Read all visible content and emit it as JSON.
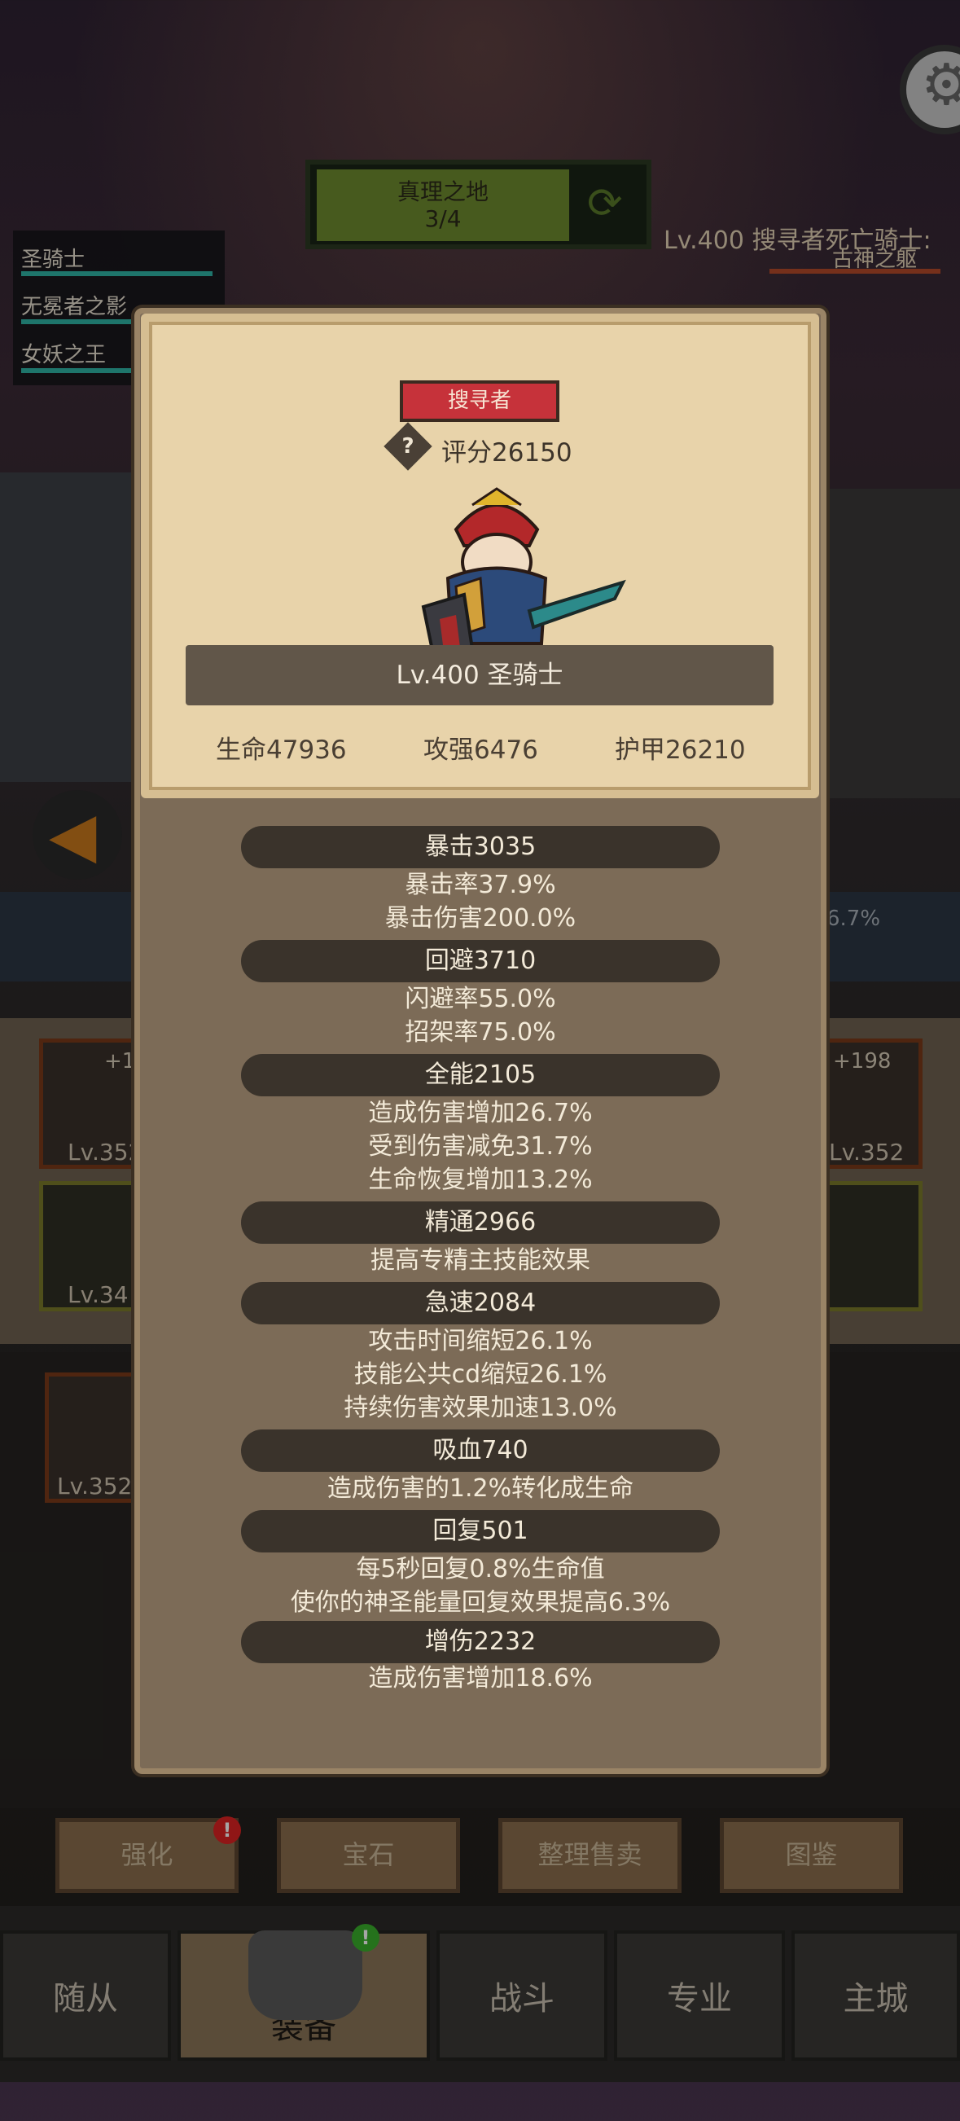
{
  "top": {
    "stage_title": "真理之地",
    "stage_progress": "3/4",
    "boss_label": "Lv.400 搜寻者死亡骑士:",
    "boss_sub": "古神之躯"
  },
  "party": [
    "圣骑士",
    "无冕者之影",
    "女妖之王"
  ],
  "background_slots": {
    "left_top_level": "Lv.352",
    "left_top_plus": "+1",
    "right_top_level": "Lv.352",
    "right_top_plus": "+198",
    "left_mid_level": "Lv.34",
    "left_low_level": "Lv.352",
    "right_pct": "6.7%"
  },
  "actions": [
    "强化",
    "宝石",
    "整理售卖",
    "图鉴"
  ],
  "nav": [
    "随从",
    "装备",
    "战斗",
    "专业",
    "主城"
  ],
  "popup": {
    "tag": "搜寻者",
    "score": "评分26150",
    "hero_name": "Lv.400 圣骑士",
    "stats": {
      "hp": "生命47936",
      "atk": "攻强6476",
      "armor": "护甲26210"
    },
    "sections": [
      {
        "header": "暴击3035",
        "lines": [
          "暴击率37.9%",
          "暴击伤害200.0%"
        ]
      },
      {
        "header": "回避3710",
        "lines": [
          "闪避率55.0%",
          "招架率75.0%"
        ]
      },
      {
        "header": "全能2105",
        "lines": [
          "造成伤害增加26.7%",
          "受到伤害减免31.7%",
          "生命恢复增加13.2%"
        ]
      },
      {
        "header": "精通2966",
        "lines": [
          "提高专精主技能效果"
        ]
      },
      {
        "header": "急速2084",
        "lines": [
          "攻击时间缩短26.1%",
          "技能公共cd缩短26.1%",
          "持续伤害效果加速13.0%"
        ]
      },
      {
        "header": "吸血740",
        "lines": [
          "造成伤害的1.2%转化成生命"
        ]
      },
      {
        "header": "回复501",
        "lines": [
          "每5秒回复0.8%生命值",
          "使你的神圣能量回复效果提高6.3%"
        ]
      },
      {
        "header": "增伤2232",
        "lines": [
          "造成伤害增加18.6%"
        ]
      }
    ]
  },
  "colors": {
    "popup_bg": "#7c6b57",
    "card_bg": "#e8d3aa",
    "tag_red": "#c6323a",
    "header_dark": "#3a332b"
  }
}
